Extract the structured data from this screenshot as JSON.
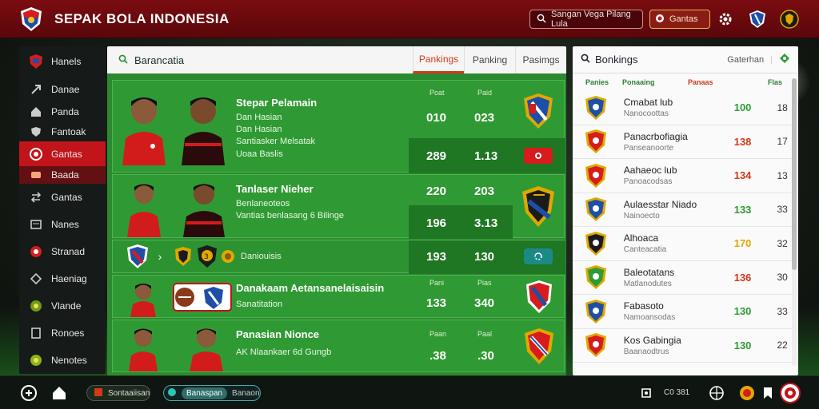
{
  "app": {
    "title": "SEPAK BOLA INDONESIA"
  },
  "topbar": {
    "search_label": "Sangan Vega Pilang Lula",
    "action_label": "Gantas"
  },
  "sidebar": {
    "items": [
      {
        "label": "Hanels",
        "icon": "crest-icon"
      },
      {
        "label": "Danae",
        "icon": "arrow-icon"
      },
      {
        "label": "Panda",
        "icon": "home-icon"
      },
      {
        "label": "Fantoak",
        "icon": "shield-icon"
      },
      {
        "label": "Gantas",
        "icon": "circle-icon"
      },
      {
        "label": "Baada",
        "icon": "tag-icon"
      },
      {
        "label": "Gantas",
        "icon": "swap-icon"
      },
      {
        "label": "Nanes",
        "icon": "list-icon"
      },
      {
        "label": "Stranad",
        "icon": "ball-icon"
      },
      {
        "label": "Haeniag",
        "icon": "diamond-icon"
      },
      {
        "label": "Vlande",
        "icon": "badge-icon"
      },
      {
        "label": "Ronoes",
        "icon": "doc-icon"
      },
      {
        "label": "Nenotes",
        "icon": "medal-icon"
      }
    ]
  },
  "center": {
    "title": "Barancatia",
    "tabs": [
      "Pankings",
      "Panking",
      "Pasimgs"
    ],
    "rows": [
      {
        "name": "Stepar Pelamain",
        "sub1": "Dan Hasian",
        "sub2": "Santiasker Melsatak",
        "sub3": "Uoaa Baslis",
        "lbl1": "Poat",
        "lbl2": "Paid",
        "v1": "010",
        "v2": "023",
        "v3": "289",
        "v4": "1.13"
      },
      {
        "name": "Tanlaser Nieher",
        "sub1": "Benlaneoteos",
        "sub2": "Vantias benlasang 6 Bilinge",
        "v1": "220",
        "v2": "203",
        "v3": "196",
        "v4": "3.13"
      },
      {
        "name": "Daniouisis",
        "v1": "193",
        "v2": "130"
      },
      {
        "name": "Danakaam Aetansanelaisaisin",
        "sub1": "Sanatitation",
        "lbl1": "Pani",
        "lbl2": "Pias",
        "v1": "133",
        "v2": "340"
      },
      {
        "name": "Panasian Nionce",
        "sub1": "AK Nlaankaer 6d Gungb",
        "lbl1": "Paan",
        "lbl2": "Paal",
        "v1": ".38",
        "v2": ".30"
      }
    ]
  },
  "right": {
    "title": "Bonkings",
    "filter": "Gaterhan",
    "columns": [
      "Panies",
      "Ponaaing",
      "Panaas",
      "Flas"
    ],
    "rows": [
      {
        "team": "Cmabat lub",
        "sub": "Nanocoottas",
        "pts": "100",
        "mp": "18",
        "color": "#2e9c34"
      },
      {
        "team": "Panacrbofiagia",
        "sub": "Panseanoorte",
        "pts": "138",
        "mp": "17",
        "color": "#d2391b"
      },
      {
        "team": "Aahaeoc lub",
        "sub": "Panoacodsas",
        "pts": "134",
        "mp": "13",
        "color": "#d2391b"
      },
      {
        "team": "Aulaesstar Niado",
        "sub": "Nainoecto",
        "pts": "133",
        "mp": "33",
        "color": "#2e9c34"
      },
      {
        "team": "Alhoaca",
        "sub": "Canteacatia",
        "pts": "170",
        "mp": "32",
        "color": "#e0a800"
      },
      {
        "team": "Baleotatans",
        "sub": "Matlanodutes",
        "pts": "136",
        "mp": "30",
        "color": "#d2391b"
      },
      {
        "team": "Fabasoto",
        "sub": "Namoansodas",
        "pts": "130",
        "mp": "33",
        "color": "#2e9c34"
      },
      {
        "team": "Kos Gabingia",
        "sub": "Baanaodtrus",
        "pts": "130",
        "mp": "22",
        "color": "#2e9c34"
      }
    ]
  },
  "bottombar": {
    "pill1": "Sontaaiisan",
    "pill2a": "Banaspan",
    "pill2b": "Banaon",
    "status": "C0 381"
  },
  "colors": {
    "brand_red": "#7a0c10",
    "accent_orange": "#d2391b",
    "pitch_green": "#2b8a2f"
  }
}
